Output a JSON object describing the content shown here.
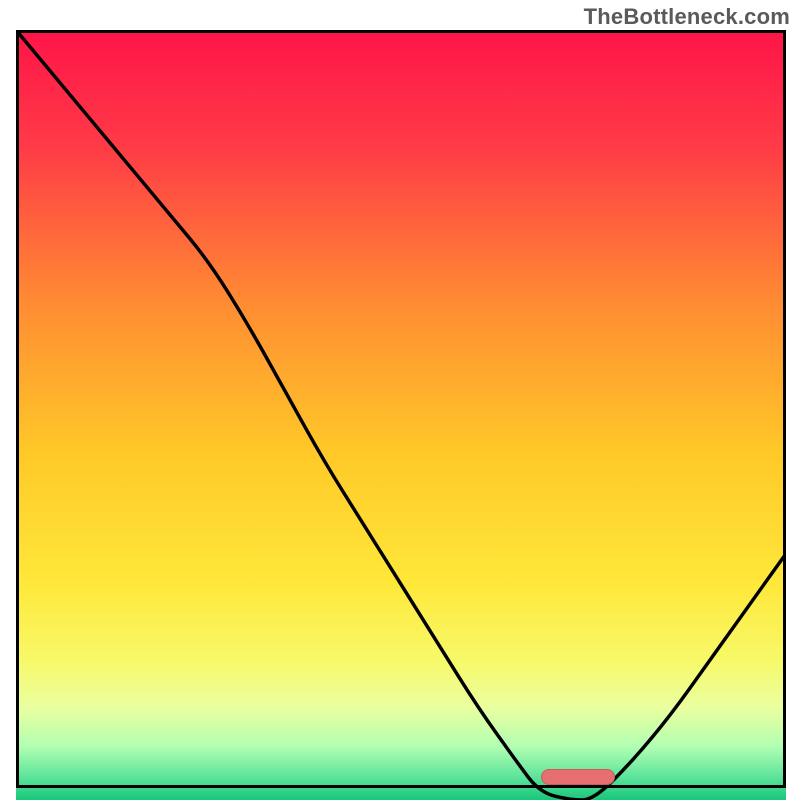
{
  "watermark": "TheBottleneck.com",
  "chart_data": {
    "type": "line",
    "title": "",
    "xlabel": "",
    "ylabel": "",
    "xlim": [
      0,
      100
    ],
    "ylim": [
      0,
      100
    ],
    "grid": false,
    "series": [
      {
        "name": "bottleneck-curve",
        "x": [
          0,
          5,
          10,
          15,
          20,
          25,
          30,
          35,
          40,
          45,
          50,
          55,
          60,
          65,
          68,
          72,
          75,
          80,
          85,
          90,
          95,
          100
        ],
        "y": [
          100,
          94,
          88,
          82,
          76,
          70,
          62,
          53,
          44,
          36,
          28,
          20,
          12,
          5,
          1,
          0,
          0,
          5,
          11,
          18,
          25,
          32
        ]
      }
    ],
    "gradient_background": {
      "type": "vertical",
      "stops": [
        {
          "offset": 0.0,
          "color": "#ff1448"
        },
        {
          "offset": 0.15,
          "color": "#ff3a47"
        },
        {
          "offset": 0.35,
          "color": "#ff8a33"
        },
        {
          "offset": 0.55,
          "color": "#ffc928"
        },
        {
          "offset": 0.72,
          "color": "#ffe83a"
        },
        {
          "offset": 0.82,
          "color": "#f7f96a"
        },
        {
          "offset": 0.88,
          "color": "#eaffa0"
        },
        {
          "offset": 0.93,
          "color": "#b2ffb2"
        },
        {
          "offset": 0.97,
          "color": "#5de49b"
        },
        {
          "offset": 1.0,
          "color": "#17c77a"
        }
      ]
    },
    "marker": {
      "name": "optimal-range-marker",
      "x": 73,
      "y": 1.5,
      "color": "#e76f6f"
    }
  }
}
